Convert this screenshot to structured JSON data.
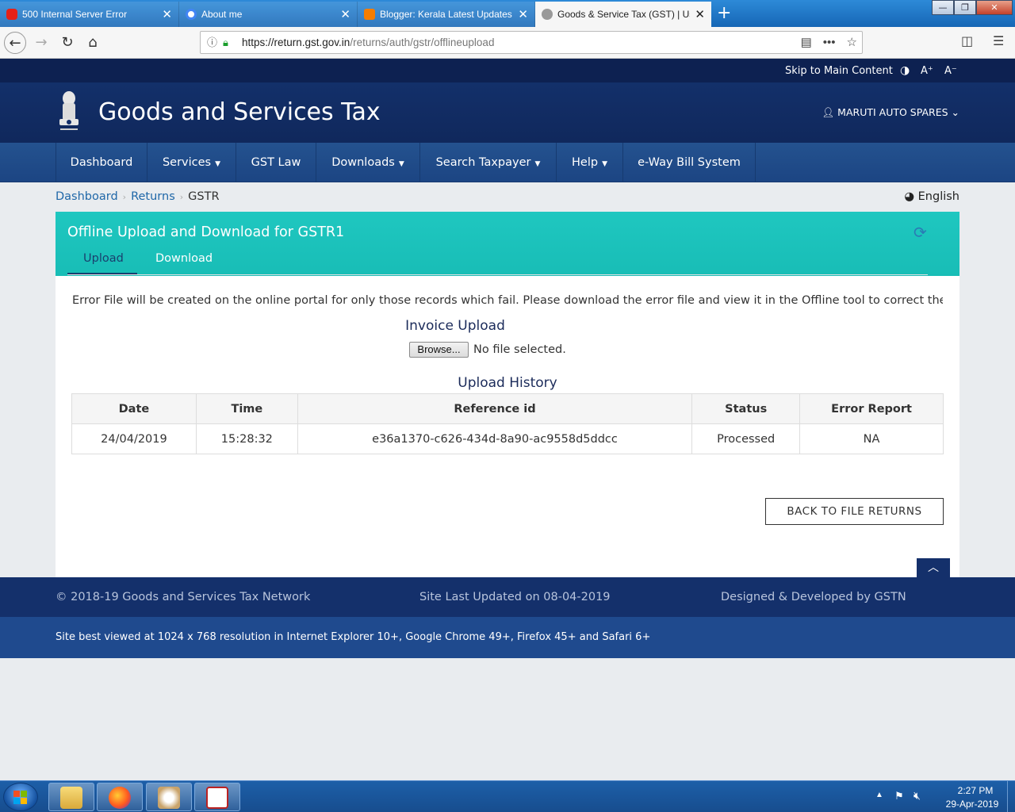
{
  "browser": {
    "tabs": [
      {
        "title": "500 Internal Server Error",
        "favicon": "youtube-icon",
        "color": "#e62117"
      },
      {
        "title": "About me",
        "favicon": "google-icon",
        "color": "#4285f4"
      },
      {
        "title": "Blogger: Kerala Latest Updates",
        "favicon": "blogger-icon",
        "color": "#f57d00"
      },
      {
        "title": "Goods & Service Tax (GST) | User",
        "favicon": "gst-emblem-icon",
        "color": "#777777"
      }
    ],
    "new_tab": "+",
    "url_host": "https://return.gst.gov.in",
    "url_path": "/returns/auth/gstr/offlineupload"
  },
  "topstrip": {
    "skip": "Skip to Main Content",
    "a_plus": "A⁺",
    "a_minus": "A⁻"
  },
  "header": {
    "title": "Goods and Services Tax",
    "user": "MARUTI AUTO SPARES"
  },
  "nav": {
    "items": [
      "Dashboard",
      "Services",
      "GST Law",
      "Downloads",
      "Search Taxpayer",
      "Help",
      "e-Way Bill System"
    ]
  },
  "breadcrumb": {
    "items": [
      "Dashboard",
      "Returns",
      "GSTR"
    ]
  },
  "language": "English",
  "card": {
    "title": "Offline Upload and Download for GSTR1",
    "tabs": [
      "Upload",
      "Download"
    ],
    "notice": "Error File will be created on the online portal for only those records which fail. Please download the error file and view it in the Offline tool to correct the sam",
    "invoice_upload": "Invoice Upload",
    "browse_label": "Browse...",
    "no_file": "No file selected.",
    "upload_history": "Upload History",
    "table": {
      "headers": [
        "Date",
        "Time",
        "Reference id",
        "Status",
        "Error Report"
      ],
      "rows": [
        [
          "24/04/2019",
          "15:28:32",
          "e36a1370-c626-434d-8a90-ac9558d5ddcc",
          "Processed",
          "NA"
        ]
      ]
    },
    "back_button": "BACK TO FILE RETURNS"
  },
  "footer": {
    "copyright": "© 2018-19 Goods and Services Tax Network",
    "updated": "Site Last Updated on 08-04-2019",
    "designed": "Designed & Developed by GSTN",
    "best_viewed": "Site best viewed at 1024 x 768 resolution in Internet Explorer 10+, Google Chrome 49+, Firefox 45+ and Safari 6+"
  },
  "taskbar": {
    "time": "2:27 PM",
    "date": "29-Apr-2019"
  },
  "colors": {
    "header_navy": "#14306b",
    "nav_blue": "#1f4a8e",
    "teal": "#1ec4be",
    "link": "#1f67a8"
  }
}
